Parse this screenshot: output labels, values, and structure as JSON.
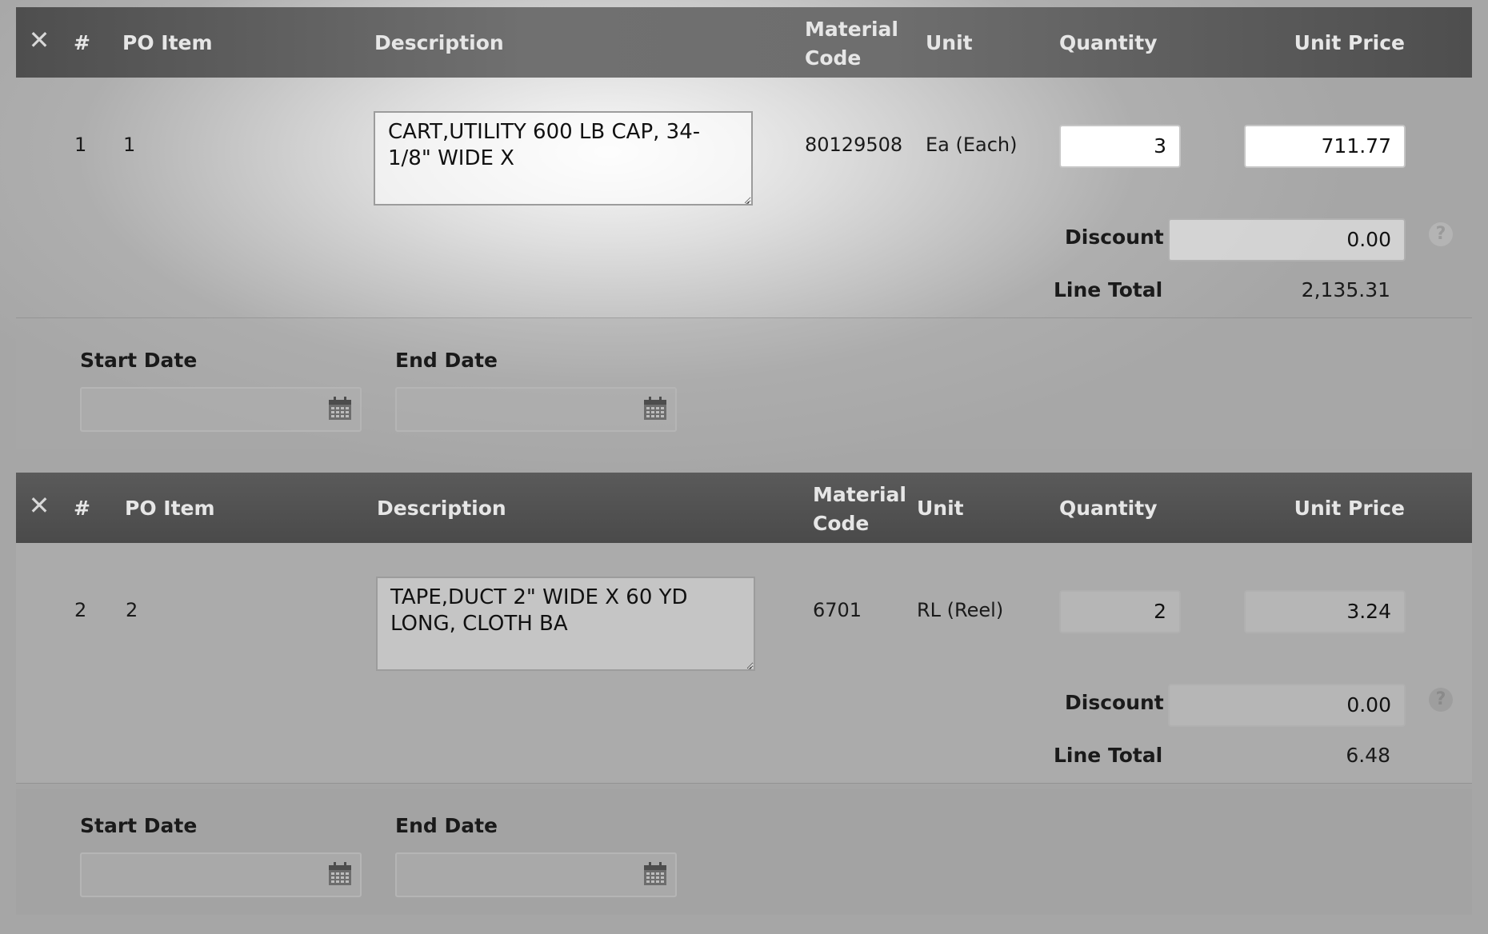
{
  "header": {
    "close_glyph": "✕",
    "num": "#",
    "po_item": "PO Item",
    "description": "Description",
    "material_code_line1": "Material",
    "material_code_line2": "Code",
    "unit": "Unit",
    "quantity": "Quantity",
    "unit_price": "Unit Price"
  },
  "labels": {
    "discount": "Discount",
    "line_total": "Line Total",
    "start_date": "Start Date",
    "end_date": "End Date",
    "help_glyph": "?"
  },
  "icons": {
    "remove": "close-icon",
    "help": "help-icon",
    "calendar": "calendar-icon"
  },
  "items": [
    {
      "num": "1",
      "po_item": "1",
      "description": "CART,UTILITY 600 LB CAP, 34-1/8\" WIDE X",
      "material_code": "80129508",
      "unit": "Ea (Each)",
      "quantity": "3",
      "unit_price": "711.77",
      "discount": "0.00",
      "line_total": "2,135.31",
      "start_date": "",
      "end_date": ""
    },
    {
      "num": "2",
      "po_item": "2",
      "description": "TAPE,DUCT 2\" WIDE X 60 YD LONG, CLOTH BA",
      "material_code": "6701",
      "unit": "RL (Reel)",
      "quantity": "2",
      "unit_price": "3.24",
      "discount": "0.00",
      "line_total": "6.48",
      "start_date": "",
      "end_date": ""
    }
  ]
}
